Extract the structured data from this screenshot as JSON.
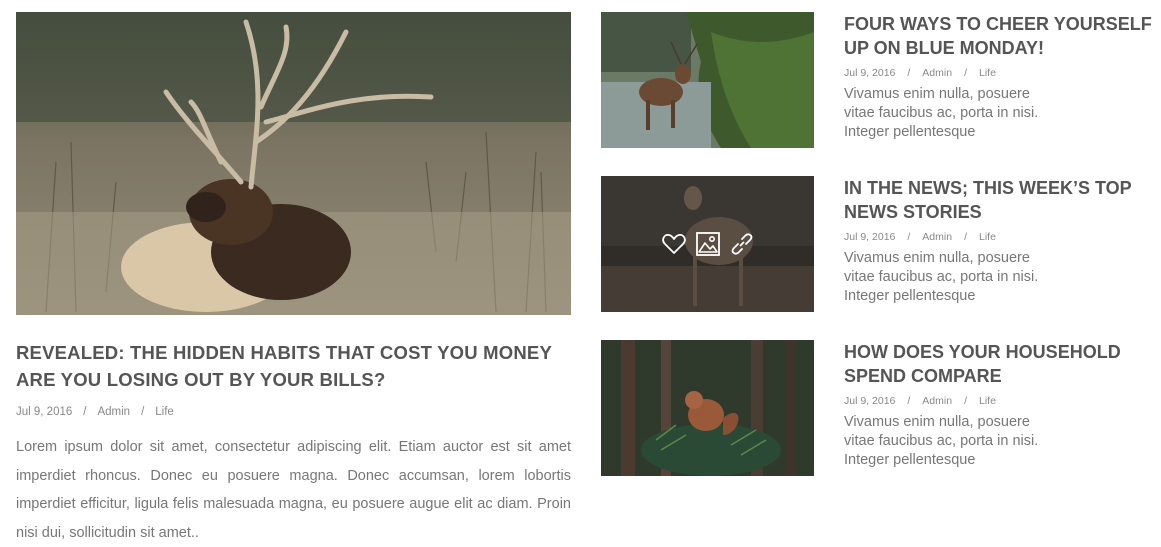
{
  "featured": {
    "image_icon": "elk-resting-photo",
    "title": "REVEALED: THE HIDDEN HABITS THAT COST YOU MONEY ARE YOU LOSING OUT BY YOUR BILLS?",
    "date": "Jul 9, 2016",
    "separator": "/",
    "author": "Admin",
    "category": "Life",
    "excerpt": "Lorem ipsum dolor sit amet, consectetur adipiscing elit. Etiam auctor est sit amet imperdiet rhoncus. Donec eu posuere magna. Donec accumsan, lorem lobortis imperdiet efficitur, ligula felis malesuada magna, eu posuere augue elit ac diam. Proin nisi dui, sollicitudin sit amet.."
  },
  "posts": [
    {
      "image_icon": "deer-in-water-photo",
      "title": "FOUR WAYS TO CHEER YOURSELF UP ON BLUE MONDAY!",
      "date": "Jul 9, 2016",
      "separator": "/",
      "author": "Admin",
      "category": "Life",
      "excerpt": "Vivamus enim nulla, posuere vitae faucibus ac, porta in nisi. Integer pellentesque"
    },
    {
      "image_icon": "fawn-photo",
      "title": "IN THE NEWS; THIS WEEK’S TOP NEWS STORIES",
      "date": "Jul 9, 2016",
      "separator": "/",
      "author": "Admin",
      "category": "Life",
      "excerpt": "Vivamus enim nulla, posuere vitae faucibus ac, porta in nisi. Integer pellentesque",
      "hover_icons": [
        "heart-icon",
        "image-icon",
        "link-icon"
      ]
    },
    {
      "image_icon": "squirrel-photo",
      "title": "HOW DOES YOUR HOUSEHOLD SPEND COMPARE",
      "date": "Jul 9, 2016",
      "separator": "/",
      "author": "Admin",
      "category": "Life",
      "excerpt": "Vivamus enim nulla, posuere vitae faucibus ac, porta in nisi. Integer pellentesque"
    }
  ]
}
